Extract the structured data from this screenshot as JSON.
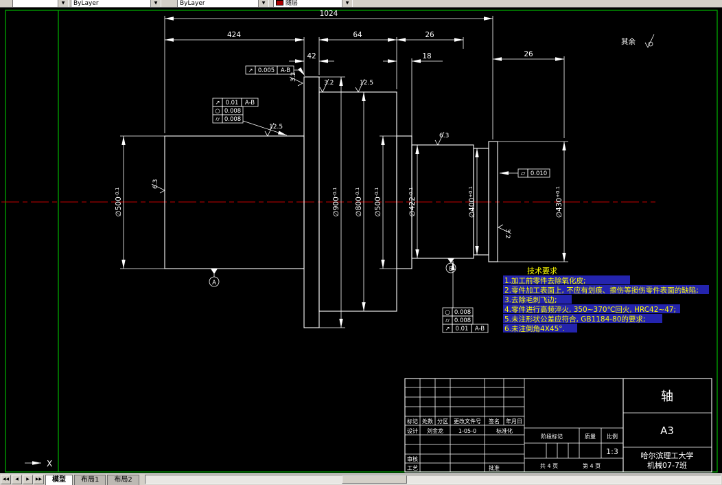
{
  "toolbar": {
    "layer_value": "",
    "color_label": "随层",
    "linetype_value": "ByLayer",
    "lineweight_value": "ByLayer"
  },
  "colors": {
    "background": "#000000",
    "geometry": "#ffffff",
    "frame": "#00b400",
    "centerline": "#c40000",
    "notes": "#ffff00",
    "note_mask": "#2424ae",
    "color_swatch": "#aa0000"
  },
  "drawing": {
    "dims": {
      "overall": "1024",
      "seg424": "424",
      "seg64": "64",
      "seg26a": "26",
      "seg42": "42",
      "seg18": "18",
      "seg26b": "26"
    },
    "diams": [
      {
        "d": "∅500",
        "tol": "-0.1"
      },
      {
        "d": "∅900",
        "tol": "-0.1"
      },
      {
        "d": "∅800",
        "tol": "-0.1"
      },
      {
        "d": "∅500",
        "tol": "-0.1"
      },
      {
        "d": "∅422",
        "tol": "-0.1"
      },
      {
        "d": "∅400",
        "tol": "+0.1"
      },
      {
        "d": "∅430",
        "tol": "+0.1"
      }
    ],
    "rough": [
      "3.2",
      "3.2",
      "12.5",
      "12.5",
      "6.3",
      "6.3",
      "3.2"
    ],
    "other_label": "其余",
    "fcf1": {
      "sym": "↗",
      "val": "0.005",
      "datum": "A-B"
    },
    "fcf2": [
      {
        "sym": "↗",
        "val": "0.01",
        "datum": "A-B"
      },
      {
        "sym": "○",
        "val": "0.008"
      },
      {
        "sym": "⌭",
        "val": "0.008"
      }
    ],
    "fcf3": {
      "sym": "▱",
      "val": "0.010"
    },
    "fcf4": [
      {
        "sym": "○",
        "val": "0.008"
      },
      {
        "sym": "⌭",
        "val": "0.008"
      },
      {
        "sym": "↗",
        "val": "0.01",
        "datum": "A-B"
      }
    ],
    "datumA": "A",
    "datumB": "B",
    "tech": {
      "title": "技术要求",
      "items": [
        "1.加工前零件去除氧化皮;",
        "2.零件加工表面上, 不应有划痕、擦伤等损伤零件表面的缺陷;",
        "3.去除毛刺飞边;",
        "4.零件进行高频淬火, 350~370℃回火, HRC42~47;",
        "5.未注形状公差应符合, GB1184-80的要求;",
        "6.未注倒角4X45°."
      ]
    },
    "ucs_x": "X"
  },
  "titleblock": {
    "part_name": "轴",
    "sheet_size": "A3",
    "school": "哈尔滨理工大学",
    "class_name": "机械07-7班",
    "scale_value": "1:3",
    "headers": [
      "标记",
      "处数",
      "分区",
      "更改文件号",
      "签名",
      "年月日"
    ],
    "design_label": "设计",
    "designer": "刘金龙",
    "date": "1-05-0",
    "std_label": "标准化",
    "check_label": "审核",
    "process_label": "工艺",
    "approve_label": "批准",
    "stage_label": "阶段标记",
    "weight_label": "质量",
    "scale_label": "比例",
    "pages_total": "共 4 页",
    "page_no": "第 4 页"
  },
  "tabs": {
    "model": "模型",
    "layout1": "布局1",
    "layout2": "布局2"
  }
}
